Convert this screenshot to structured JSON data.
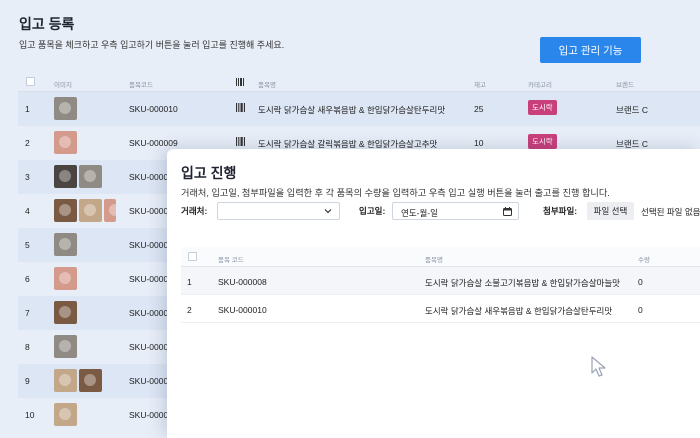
{
  "page": {
    "title": "입고 등록",
    "subtitle": "입고 품목을 체크하고 우측 입고하기 버튼을 눌러 입고를 진행해 주세요.",
    "manage_button": "입고 관리 기능"
  },
  "table": {
    "columns": {
      "image": "이미지",
      "code": "품목코드",
      "name": "품목명",
      "stock": "재고",
      "category": "카테고리",
      "brand": "브랜드"
    },
    "rows": [
      {
        "num": "1",
        "sku": "SKU-000010",
        "name": "도시락 닭가슴살 새우볶음밥 & 한입닭가슴살탄두리맛",
        "stock": "25",
        "category": "도시락",
        "brand": "브랜드 C"
      },
      {
        "num": "2",
        "sku": "SKU-000009",
        "name": "도시락 닭가슴살 갈릭볶음밥 & 한입닭가슴살고추맛",
        "stock": "10",
        "category": "도시락",
        "brand": "브랜드 C"
      },
      {
        "num": "3",
        "sku": "SKU-0000"
      },
      {
        "num": "4",
        "sku": "SKU-0000"
      },
      {
        "num": "5",
        "sku": "SKU-0000"
      },
      {
        "num": "6",
        "sku": "SKU-0000"
      },
      {
        "num": "7",
        "sku": "SKU-0000"
      },
      {
        "num": "8",
        "sku": "SKU-0000"
      },
      {
        "num": "9",
        "sku": "SKU-0000"
      },
      {
        "num": "10",
        "sku": "SKU-0000"
      }
    ]
  },
  "modal": {
    "title": "입고 진행",
    "subtitle": "거래처, 입고일, 첨부파일을 입력한 후 각 품목의 수량을 입력하고 우측 입고 실행 버튼을 눌러 출고를 진행 합니다.",
    "vendor_label": "거래처:",
    "vendor_value": "",
    "date_label": "입고일:",
    "date_value": "연도-월-일",
    "file_label": "첨부파일:",
    "file_button": "파일 선택",
    "file_status": "선택된 파일 없음",
    "columns": {
      "code": "품목 코드",
      "name": "품목명",
      "qty": "수량"
    },
    "rows": [
      {
        "num": "1",
        "sku": "SKU-000008",
        "name": "도시락 닭가슴살 소불고기볶음밥 & 한입닭가슴살마늘맛",
        "qty": "0"
      },
      {
        "num": "2",
        "sku": "SKU-000010",
        "name": "도시락 닭가슴살 새우볶음밥 & 한입닭가슴살탄두리맛",
        "qty": "0"
      }
    ]
  },
  "colors": {
    "accent": "#2b86ec",
    "badge": "#c93f7c"
  },
  "icons": [
    "barcode-icon",
    "chevron-down-icon",
    "calendar-icon",
    "mouse-cursor-icon"
  ]
}
